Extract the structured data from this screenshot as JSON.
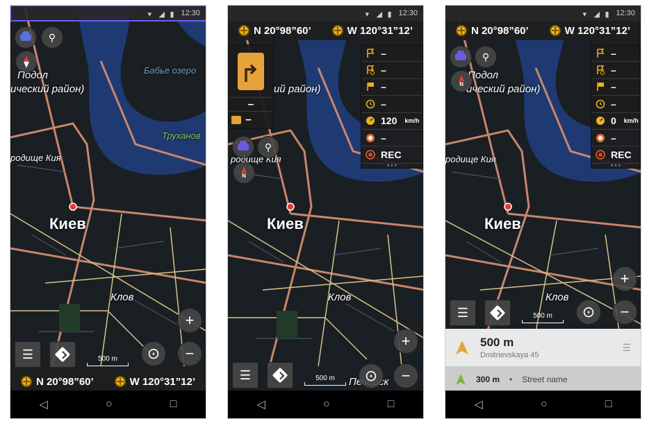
{
  "status_bar": {
    "time": "12:30"
  },
  "coordinates": {
    "lat": "N 20°98”60’",
    "lon": "W 120°31”12’"
  },
  "map_labels": {
    "city": "Киев",
    "podol": "Подол",
    "district": "ический район)",
    "district2": "ий район)",
    "lake": "Бабье озеро",
    "island": "Труханов",
    "uroch": "родище Кия",
    "uroch2": "родище Кия",
    "klov": "Клов",
    "pechersk": "Печерск"
  },
  "scale": {
    "label": "500 m"
  },
  "widgets_phone2": [
    {
      "icon": "flag-icon",
      "value": "–"
    },
    {
      "icon": "flag-route-icon",
      "value": "–"
    },
    {
      "icon": "finish-flag-icon",
      "value": "–"
    },
    {
      "icon": "clock-icon",
      "value": "–"
    },
    {
      "icon": "speed-icon",
      "value": "120",
      "unit": "km/h"
    },
    {
      "icon": "speed-limit-icon",
      "value": "–"
    },
    {
      "icon": "record-icon",
      "value": "REC"
    }
  ],
  "widgets_phone3": [
    {
      "icon": "flag-icon",
      "value": "–"
    },
    {
      "icon": "flag-route-icon",
      "value": "–"
    },
    {
      "icon": "finish-flag-icon",
      "value": "–"
    },
    {
      "icon": "clock-icon",
      "value": "–"
    },
    {
      "icon": "speed-icon",
      "value": "0",
      "unit": "km/h"
    },
    {
      "icon": "speed-limit-icon",
      "value": "–"
    },
    {
      "icon": "record-icon",
      "value": "REC"
    }
  ],
  "turn_panel": {
    "distance": "–",
    "lane": "–"
  },
  "compass": {
    "label": "N"
  },
  "route": {
    "next_distance": "500 m",
    "next_street": "Dmitrievskaya 45",
    "then_distance": "300 m",
    "then_separator": "•",
    "then_street": "Street name"
  },
  "zoom": {
    "in": "+",
    "out": "−"
  },
  "colors": {
    "accent": "#e8a23a",
    "selection": "#6f5cf5",
    "map_bg": "#1a1f24",
    "water": "#1f3a73"
  }
}
